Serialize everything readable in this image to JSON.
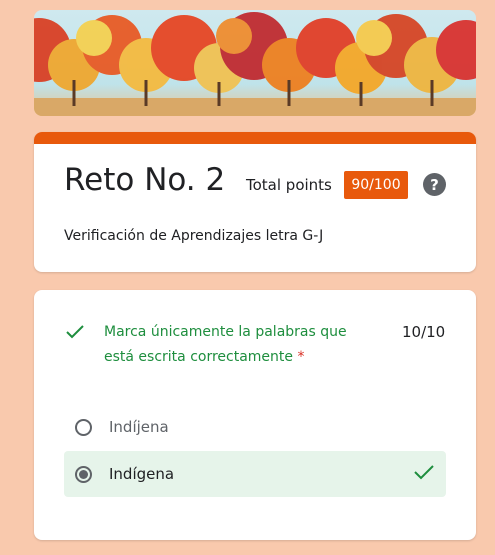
{
  "form": {
    "title": "Reto No. 2",
    "total_points_label": "Total points",
    "score": "90/100",
    "help_glyph": "?",
    "description": "Verificación de Aprendizajes letra G-J",
    "accent_color": "#e8590c"
  },
  "question": {
    "status_icon": "check-icon",
    "text": "Marca únicamente la palabras que está escrita correctamente",
    "required_mark": "*",
    "points": "10/10",
    "options": [
      {
        "label": "Indíjena",
        "selected": false
      },
      {
        "label": "Indígena",
        "selected": true,
        "correct": true
      }
    ]
  }
}
